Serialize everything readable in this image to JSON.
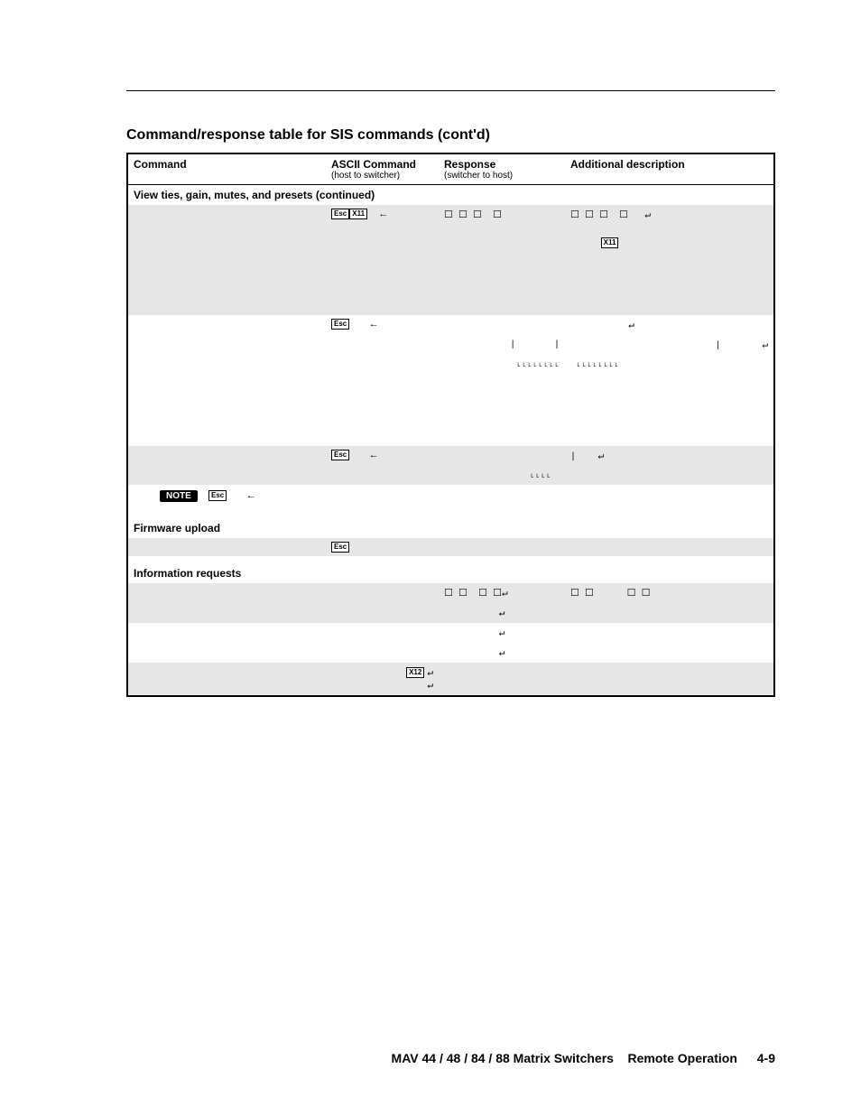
{
  "section_title": "Command/response table for SIS commands (cont'd)",
  "header": {
    "c1": "Command",
    "c2": "ASCII Command",
    "c2_sub": "(host to switcher)",
    "c3": "Response",
    "c3_sub": "(switcher to host)",
    "c4": "Additional description"
  },
  "subheads": {
    "view_ties": "View ties, gain, mutes, and presets (continued)",
    "firmware": "Firmware upload",
    "info": "Information requests"
  },
  "keycaps": {
    "esc": "Esc",
    "x11": "X11",
    "x12": "X12"
  },
  "glyphs": {
    "arrow_left": "←",
    "enter": "↵",
    "box": "☐",
    "vbar": "|",
    "tally": "˪˪˪˪˪˪˪˪",
    "tally4": "˪˪˪˪"
  },
  "note_label": "NOTE",
  "footer": {
    "left": "MAV 44 / 48 / 84 / 88 Matrix Switchers",
    "middle": "Remote Operation",
    "page": "4-9"
  }
}
